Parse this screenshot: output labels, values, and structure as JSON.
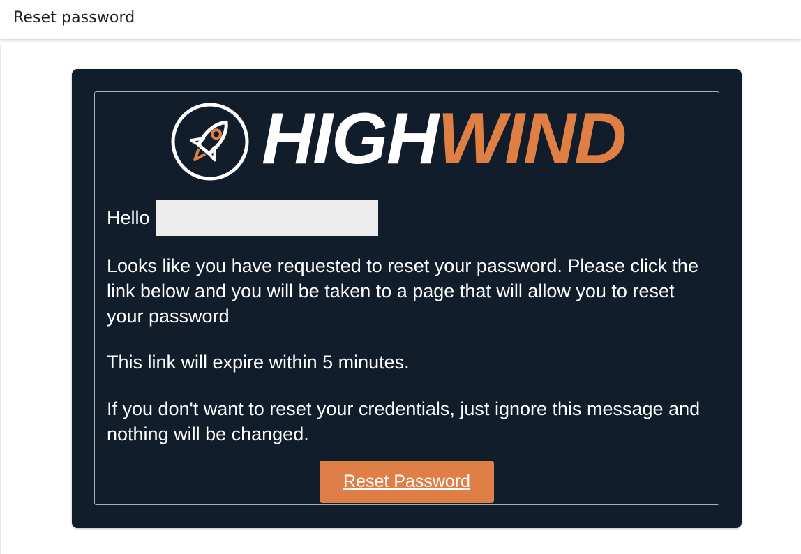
{
  "window": {
    "title": "Reset password"
  },
  "email": {
    "logo": {
      "word_high": "HIGH",
      "word_wind": "WIND",
      "icon": "rocket-icon"
    },
    "greeting": "Hello",
    "paragraphs": [
      "Looks like you have requested to reset your password. Please click the link below and you will be taken to a page that will allow you to reset your password",
      "This link will expire within 5 minutes.",
      "If you don't want to reset your credentials, just ignore this message and nothing will be changed."
    ],
    "button_label": "Reset Password"
  },
  "colors": {
    "card_background": "#121d2c",
    "accent_orange": "#df7f47",
    "text_white": "#ffffff",
    "redaction": "#ececec"
  }
}
